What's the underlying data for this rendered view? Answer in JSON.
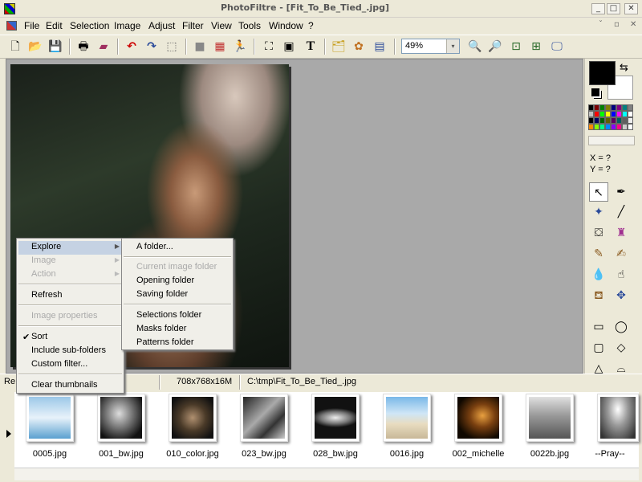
{
  "window": {
    "title": "PhotoFiltre - [Fit_To_Be_Tied_.jpg]",
    "minimize": "_",
    "maximize": "□",
    "close": "✕"
  },
  "menubar": {
    "items": [
      "File",
      "Edit",
      "Selection",
      "Image",
      "Adjust",
      "Filter",
      "View",
      "Tools",
      "Window",
      "?"
    ],
    "mdi_minimize": "ˇ",
    "mdi_restore": "▫",
    "mdi_close": "✕"
  },
  "toolbar": {
    "zoom_value": "49%",
    "zoom_arrow": "▾"
  },
  "status": {
    "left": "Re",
    "dimensions": "708x768x16M",
    "path": "C:\\tmp\\Fit_To_Be_Tied_.jpg"
  },
  "colors": {
    "foreground": "#000000",
    "background": "#ffffff"
  },
  "coords": {
    "x": "X = ?",
    "y": "Y = ?"
  },
  "context_menu": {
    "explore": "Explore",
    "image": "Image",
    "action": "Action",
    "refresh": "Refresh",
    "image_properties": "Image properties",
    "sort": "Sort",
    "include_subfolders": "Include sub-folders",
    "custom_filter": "Custom filter...",
    "clear_thumbnails": "Clear thumbnails",
    "check": "✔",
    "chevron": "▶"
  },
  "submenu": {
    "a_folder": "A folder...",
    "current_image_folder": "Current image folder",
    "opening_folder": "Opening folder",
    "saving_folder": "Saving folder",
    "selections_folder": "Selections folder",
    "masks_folder": "Masks folder",
    "patterns_folder": "Patterns folder"
  },
  "thumbnails": [
    "0005.jpg",
    "001_bw.jpg",
    "010_color.jpg",
    "023_bw.jpg",
    "028_bw.jpg",
    "0016.jpg",
    "002_michelle",
    "0022b.jpg",
    "--Pray--"
  ]
}
